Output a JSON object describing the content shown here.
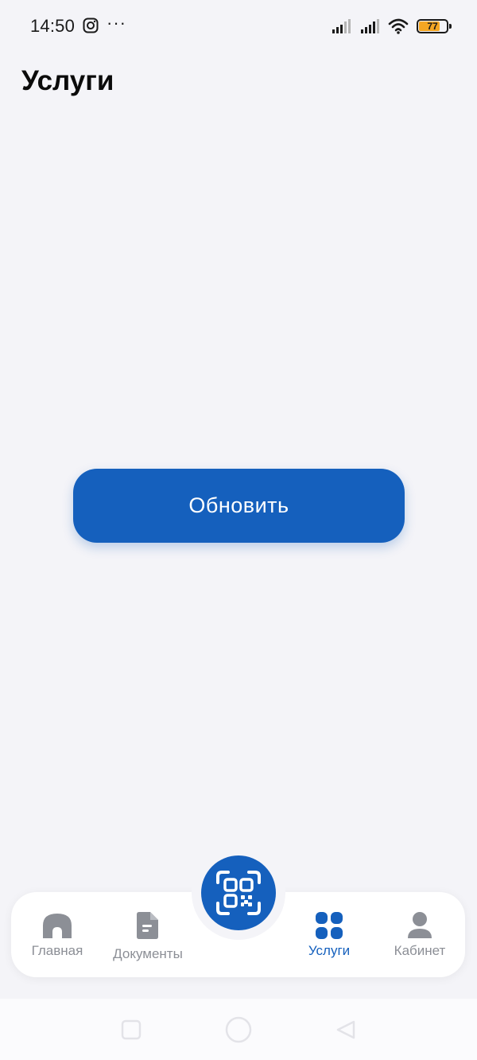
{
  "status_bar": {
    "time": "14:50",
    "more": "···",
    "battery_level": "77",
    "battery_fraction": 0.77,
    "icons": [
      "instagram-icon",
      "signal-icon",
      "signal-icon",
      "wifi-icon",
      "battery-icon"
    ]
  },
  "header": {
    "title": "Услуги"
  },
  "main": {
    "refresh_label": "Обновить"
  },
  "bottom_nav": {
    "items": [
      {
        "label": "Главная",
        "icon": "home-icon",
        "active": false
      },
      {
        "label": "Документы",
        "icon": "document-icon",
        "active": false
      },
      {
        "label": "Услуги",
        "icon": "services-grid-icon",
        "active": true
      },
      {
        "label": "Кабинет",
        "icon": "profile-icon",
        "active": false
      }
    ],
    "center_button_icon": "qr-scan-icon"
  },
  "system_nav": {
    "icons": [
      "recents-icon",
      "home-circle-icon",
      "back-icon"
    ]
  },
  "colors": {
    "accent": "#1560bd",
    "background": "#f4f4f8",
    "inactive": "#8c8f96",
    "battery": "#f5a623"
  }
}
